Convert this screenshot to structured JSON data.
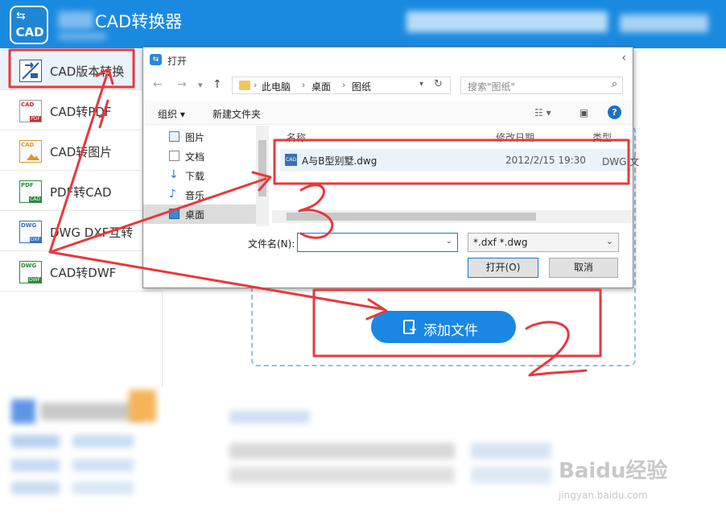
{
  "window": {
    "logo_text": "CAD",
    "title": "CAD转换器"
  },
  "sidebar": {
    "items": [
      {
        "label": "CAD版本转换",
        "icon": "cad-version-icon",
        "icon_top": "",
        "icon_bottom": ""
      },
      {
        "label": "CAD转PDF",
        "icon": "cad-to-pdf-icon",
        "icon_top": "CAD",
        "icon_bottom": "PDF"
      },
      {
        "label": "CAD转图片",
        "icon": "cad-to-image-icon",
        "icon_top": "CAD",
        "icon_bottom": ""
      },
      {
        "label": "PDF转CAD",
        "icon": "pdf-to-cad-icon",
        "icon_top": "PDF",
        "icon_bottom": "CAD"
      },
      {
        "label": "DWG DXF互转",
        "icon": "dwg-dxf-icon",
        "icon_top": "DWG",
        "icon_bottom": "DXF"
      },
      {
        "label": "CAD转DWF",
        "icon": "cad-to-dwf-icon",
        "icon_top": "DWG",
        "icon_bottom": "DWF"
      }
    ]
  },
  "main": {
    "add_button": "添加文件"
  },
  "dialog": {
    "title": "打开",
    "breadcrumb": [
      "此电脑",
      "桌面",
      "图纸"
    ],
    "search_placeholder": "搜索\"图纸\"",
    "toolbar": {
      "organize": "组织 ▾",
      "new_folder": "新建文件夹",
      "help": "?"
    },
    "nav_items": [
      {
        "label": "图片",
        "icon": "pictures-icon"
      },
      {
        "label": "文档",
        "icon": "documents-icon"
      },
      {
        "label": "下载",
        "icon": "downloads-icon"
      },
      {
        "label": "音乐",
        "icon": "music-icon"
      },
      {
        "label": "桌面",
        "icon": "desktop-icon"
      }
    ],
    "columns": {
      "name": "名称",
      "date": "修改日期",
      "type": "类型"
    },
    "files": [
      {
        "name": "A与B型别墅.dwg",
        "date": "2012/2/15 19:30",
        "type": "DWG 文",
        "icon_text": "CAD"
      }
    ],
    "filename_label": "文件名(N):",
    "filename_value": "",
    "filter": "*.dxf *.dwg",
    "open_button": "打开(O)",
    "cancel_button": "取消"
  },
  "annotations": [
    "1",
    "2",
    "3"
  ],
  "watermark": {
    "logo": "Baidu经验",
    "url": "jingyan.baidu.com"
  },
  "colors": {
    "accent": "#1a8ae0",
    "annotation": "#e8383d",
    "button": "#1a87e4"
  }
}
